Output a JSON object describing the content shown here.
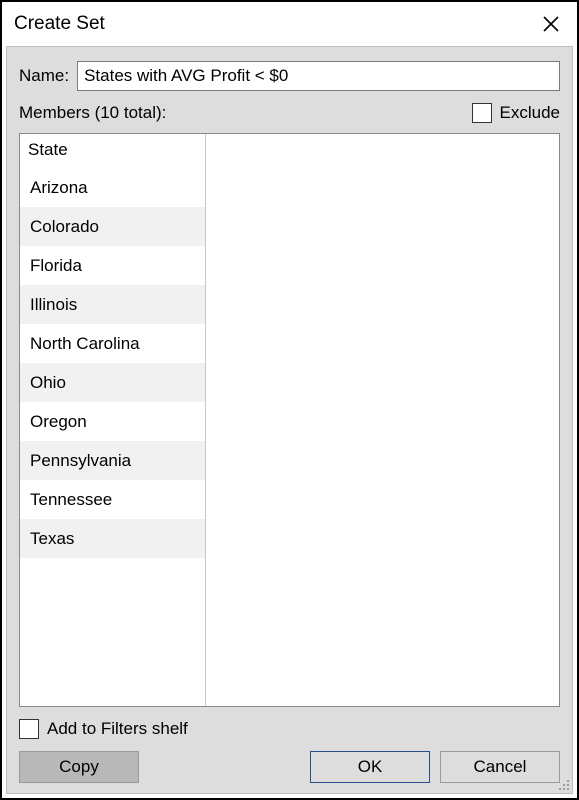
{
  "dialog": {
    "title": "Create Set"
  },
  "name": {
    "label": "Name:",
    "value": "States with AVG Profit < $0"
  },
  "members": {
    "label": "Members (10 total):",
    "exclude_label": "Exclude",
    "col_header": "State",
    "items": [
      "Arizona",
      "Colorado",
      "Florida",
      "Illinois",
      "North Carolina",
      "Ohio",
      "Oregon",
      "Pennsylvania",
      "Tennessee",
      "Texas"
    ]
  },
  "footer": {
    "add_filters_label": "Add to Filters shelf",
    "copy_label": "Copy",
    "ok_label": "OK",
    "cancel_label": "Cancel"
  }
}
